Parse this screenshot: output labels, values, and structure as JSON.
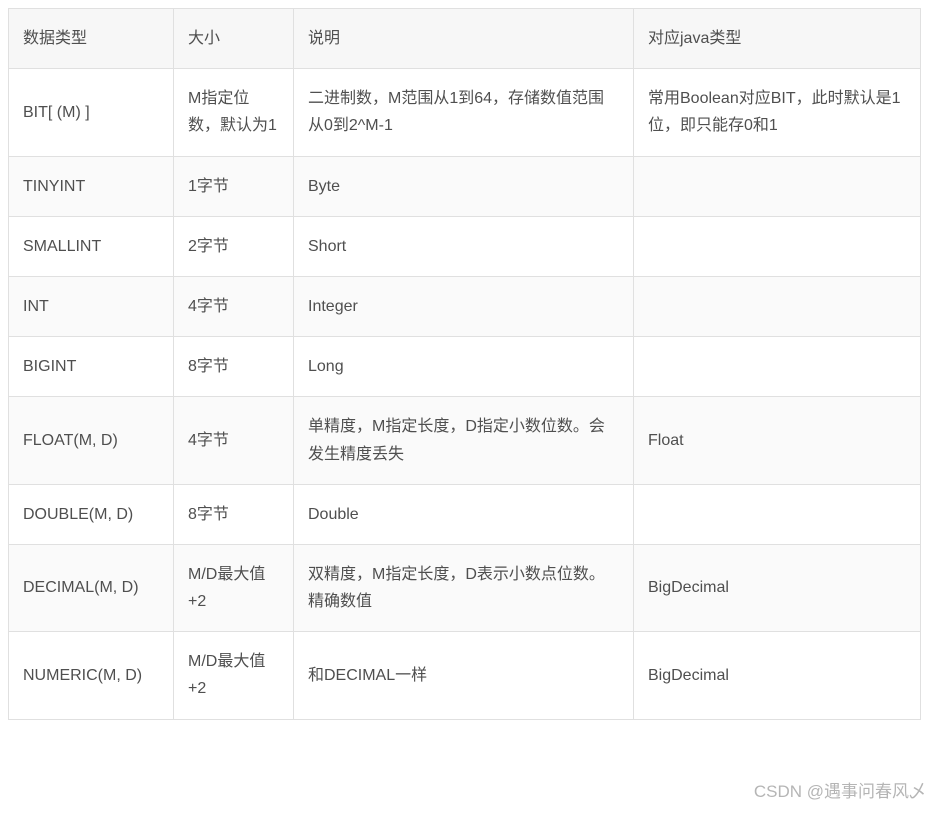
{
  "table": {
    "headers": [
      "数据类型",
      "大小",
      "说明",
      "对应java类型"
    ],
    "rows": [
      {
        "type": "BIT[ (M) ]",
        "size": "M指定位数，默认为1",
        "desc": "二进制数，M范围从1到64，存储数值范围从0到2^M-1",
        "java": "常用Boolean对应BIT，此时默认是1位，即只能存0和1"
      },
      {
        "type": "TINYINT",
        "size": "1字节",
        "desc": "Byte",
        "java": ""
      },
      {
        "type": "SMALLINT",
        "size": "2字节",
        "desc": "Short",
        "java": ""
      },
      {
        "type": "INT",
        "size": "4字节",
        "desc": "Integer",
        "java": ""
      },
      {
        "type": "BIGINT",
        "size": "8字节",
        "desc": "Long",
        "java": ""
      },
      {
        "type": "FLOAT(M, D)",
        "size": "4字节",
        "desc": "单精度，M指定长度，D指定小数位数。会发生精度丢失",
        "java": "Float"
      },
      {
        "type": "DOUBLE(M, D)",
        "size": "8字节",
        "desc": "Double",
        "java": ""
      },
      {
        "type": "DECIMAL(M, D)",
        "size": "M/D最大值+2",
        "desc": "双精度，M指定长度，D表示小数点位数。精确数值",
        "java": "BigDecimal"
      },
      {
        "type": "NUMERIC(M, D)",
        "size": "M/D最大值+2",
        "desc": "和DECIMAL一样",
        "java": "BigDecimal"
      }
    ]
  },
  "watermark": "CSDN @遇事问春风乄"
}
